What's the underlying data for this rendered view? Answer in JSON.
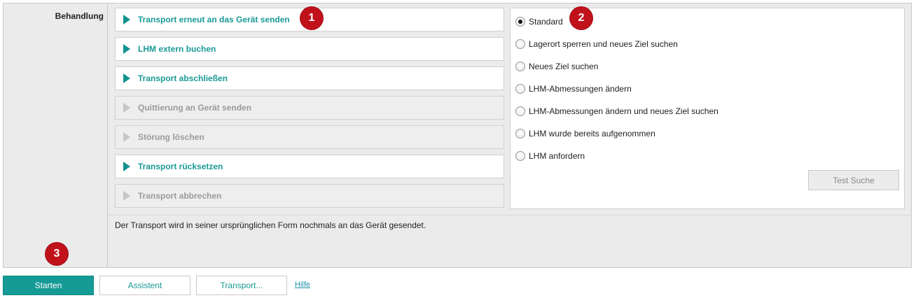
{
  "section": {
    "label": "Behandlung"
  },
  "actions": [
    {
      "label": "Transport erneut an das Gerät senden",
      "enabled": true
    },
    {
      "label": "LHM extern buchen",
      "enabled": true
    },
    {
      "label": "Transport abschließen",
      "enabled": true
    },
    {
      "label": "Quittierung an Gerät senden",
      "enabled": false
    },
    {
      "label": "Störung löschen",
      "enabled": false
    },
    {
      "label": "Transport rücksetzen",
      "enabled": true
    },
    {
      "label": "Transport abbrechen",
      "enabled": false
    }
  ],
  "options": [
    {
      "label": "Standard",
      "checked": true
    },
    {
      "label": "Lagerort sperren und neues Ziel suchen",
      "checked": false
    },
    {
      "label": "Neues Ziel suchen",
      "checked": false
    },
    {
      "label": "LHM-Abmessungen ändern",
      "checked": false
    },
    {
      "label": "LHM-Abmessungen ändern und neues Ziel suchen",
      "checked": false
    },
    {
      "label": "LHM wurde bereits aufgenommen",
      "checked": false
    },
    {
      "label": "LHM anfordern",
      "checked": false
    }
  ],
  "test_button": {
    "label": "Test Suche",
    "enabled": false
  },
  "description": "Der Transport wird in seiner ursprünglichen Form nochmals an das Gerät gesendet.",
  "badges": {
    "b1": "1",
    "b2": "2",
    "b3": "3"
  },
  "footer": {
    "start_label": "Starten",
    "assistant_label": "Assistent",
    "transport_label": "Transport...",
    "help_label": "Hilfe"
  },
  "colors": {
    "accent": "#159a95",
    "badge": "#c1121c",
    "disabled_text": "#9a9a9a"
  }
}
